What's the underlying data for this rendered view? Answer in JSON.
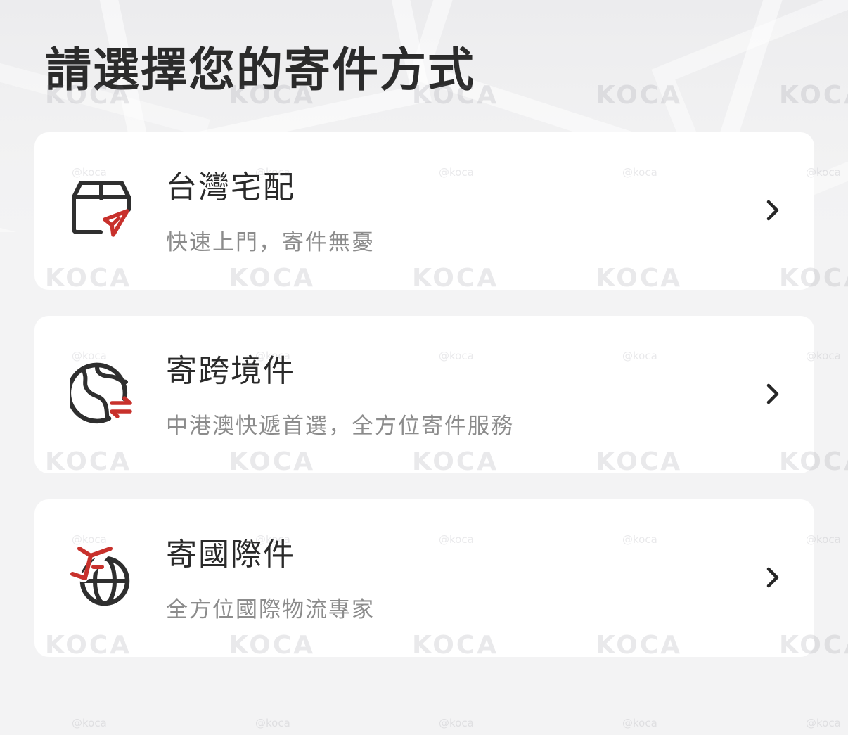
{
  "header": {
    "title": "請選擇您的寄件方式"
  },
  "options": [
    {
      "title": "台灣宅配",
      "subtitle": "快速上門，寄件無憂",
      "icon": "parcel-box-send-icon"
    },
    {
      "title": "寄跨境件",
      "subtitle": "中港澳快遞首選，全方位寄件服務",
      "icon": "globe-exchange-icon"
    },
    {
      "title": "寄國際件",
      "subtitle": "全方位國際物流專家",
      "icon": "globe-plane-icon"
    }
  ],
  "watermark": {
    "large": "KOCA",
    "small": "@koca"
  },
  "colors": {
    "background": "#f3f3f4",
    "card": "#ffffff",
    "title_text": "#2b2b2b",
    "subtitle_text": "#8c8c8c",
    "icon_dark": "#2f2f2f",
    "icon_accent": "#c8312c"
  }
}
